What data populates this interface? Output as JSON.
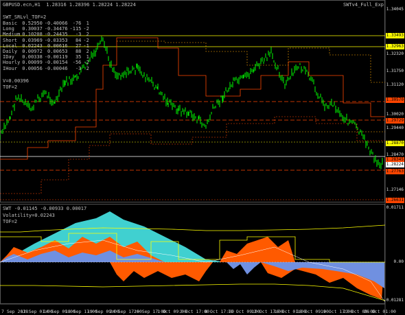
{
  "header": {
    "symbol_info": "GBPUSD.ecn,H1  1.28316 1.28396 1.28224 1.28224",
    "indicator_name": "SWTv4_Full_Exp"
  },
  "indicator_title": "SWT_SRLvl_TOF=2",
  "stats_rows": [
    {
      "label": "Basic",
      "v1": "0.52950",
      "v2": "-0.40066",
      "v3": "-76",
      "v4": "1"
    },
    {
      "label": "Long",
      "v1": "0.30037",
      "v2": "-0.34476",
      "v3": "-115",
      "v4": "-2"
    },
    {
      "label": "Medium",
      "v1": "0.10208",
      "v2": "-0.24435",
      "v3": "-3",
      "v4": "2"
    },
    {
      "label": "Short",
      "v1": "0.03969",
      "v2": "-0.03353",
      "v3": "84",
      "v4": "-2"
    },
    {
      "label": "Local",
      "v1": "0.02243",
      "v2": "0.00616",
      "v3": "27",
      "v4": "-1"
    },
    {
      "label": "Daily",
      "v1": "0.00972",
      "v2": "0.00653",
      "v3": "88",
      "v4": "2"
    },
    {
      "label": "IDay",
      "v1": "0.00338",
      "v2": "-0.00119",
      "v3": "35",
      "v4": "1"
    },
    {
      "label": "Hourly",
      "v1": "0.00099",
      "v2": "-0.00154",
      "v3": "-56",
      "v4": "-2"
    },
    {
      "label": "IHour",
      "v1": "0.00056",
      "v2": "-0.00046",
      "v3": "-3",
      "v4": "2"
    }
  ],
  "v_line": "V=0.00396",
  "tof_line": "TOF=2",
  "lower_panel": {
    "title": "SWT -0.01145 -0.00933 0.00017",
    "volatility": "Volatility=0.02243",
    "tof": "TOF=2",
    "scale": [
      "0.01711",
      "0.00",
      "-0.01281"
    ]
  },
  "price_scale": [
    "1.34045",
    "1.33493",
    "1.32963",
    "1.32320",
    "1.31750",
    "1.31120",
    "1.30570",
    "1.30020",
    "1.29729",
    "1.29440",
    "1.28870",
    "1.28470",
    "1.28345",
    "1.28224",
    "1.27763",
    "1.27146",
    "1.26631"
  ],
  "dates": [
    "7 Sep 2018",
    "12 Sep 01:00",
    "14 Sep 09:00",
    "18 Sep 17:00",
    "19 Sep 09:00",
    "24 Sep 17:00",
    "26 Sep 17:00",
    "1 Oct 09:00",
    "3 Oct 17:00",
    "8 Oct 17:00",
    "11 Oct 09:00",
    "12 Oct 17:00",
    "16 Oct 01:00",
    "18 Oct 09:00",
    "19 Oct 17:00",
    "23 Oct 09:00",
    "26 Oct 01:00"
  ],
  "colors": {
    "background": "#000000",
    "candles_up": "#00ff00",
    "level_lines": "#ff4500",
    "level_dotted": "#ffa500",
    "yellow_lines": "#ffff00",
    "cyan_fill": "#40d0d0",
    "orange_fill": "#ff5a00",
    "blue_fill": "#7090e0"
  }
}
